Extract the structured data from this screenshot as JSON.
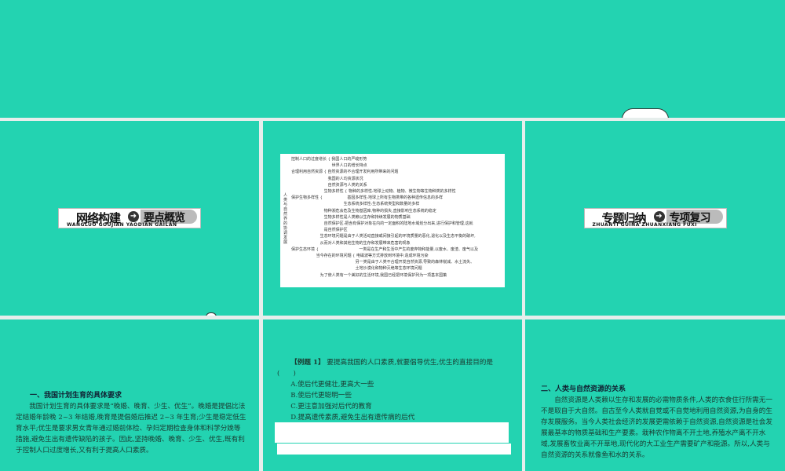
{
  "slides": [
    {
      "id": 1
    },
    {
      "id": 2,
      "banner": {
        "left": "网络构建",
        "right": "要点概览",
        "pinyin": "WANGLUO GOUJIAN YAODIAN GAILAN"
      }
    },
    {
      "id": 3,
      "mindmap": {
        "root": "人类与自然界的协调发展",
        "rows": [
          "控制人口的过度增长 { 我国人口的严峻形势",
          "　　　　　　　　　　 世界人口的增长特点",
          "合理利用自然资源 { 自然资源的不合理开发利用所带来的问题",
          "　　　　　　　　　 我国的人均资源状况",
          "　　　　　　　　　 自然资源与人类的关系",
          "　　　　　　　　 生物多样性 { 物种的多样性:地球上动物、植物、微生物等生物种类的多样性",
          "保护生物多样性 {　　　　　　 基因多样性:地球上所有生物携带的各种遗传信息的多样",
          "　　　　　　　　　　　　　 生态系统多样性:生态系统类型和数量的多样",
          "　　　　　　　　 物种濒危会危及生物基因库,物种的损失,直接影响生态系统的稳定",
          "　　　　　　　　 生物多样性是人类赖以生存和持续发展的物质基础",
          "　　　　　　　　 自然保护区:把含有保护对象在内的一定面积的陆地水域划分出来,进行保护和管理,这就",
          "　　　　　　　　 是自然保护区",
          "　　　　　　　 生态环境问题是由于人类活动直接或间接引起的环境质量的恶化,退化以及生态平衡的破坏,",
          "　　　　　　　 从而对人类和其他生物的生存和发展带来危害的现象",
          "保护生态环境 {　　　　　　　　　　 一类是在生产和生活中产生的废弃物和能量,以废水、废渣、废气以及",
          "　　　　　　 当今存在的环境问题 { 电磁波等方式排放到环境中,造成环境污染",
          "　　　　　　　　　　　　　　　　 另一类是由于人类不合理开发自然资源,导致的森林锐减、水土流失、",
          "　　　　　　　　　　　　　　　　 土地沙漠化和物种灭绝等生态环境问题",
          "　　　　　　　 为了使人类有一个美好的生活环境,我国已经把环境保护列为一项基本国策"
        ]
      }
    },
    {
      "id": 4,
      "banner": {
        "left": "专题归纳",
        "right": "专项复习",
        "pinyin": "ZHUANTI GUINA ZHUANXIANG FUXI"
      }
    },
    {
      "id": 5,
      "heading": "一、我国计划生育的具体要求",
      "body": "我国计划生育的具体要求是“晚婚、晚育、少生、优生”。晚婚是提倡比法定结婚年龄晚 2~3 年结婚,晚育是提倡婚后推迟 2~3 年生育;少生是稳定低生育水平;优生是要求男女青年通过婚前体检、孕妇定期检查身体和科学分娩等措施,避免生出有遗传缺陷的孩子。因此,坚持晚婚、晚育、少生、优生,既有利于控制人口过度增长,又有利于提高人口素质。"
    },
    {
      "id": 6,
      "question_label": "【例题 1】",
      "question": "要提高我国的人口素质,就要倡导优生,优生的直接目的是(　　)",
      "options": [
        "A.使后代更健壮,更高大一些",
        "B.使后代更聪明一些",
        "C.更注意加强对后代的教育",
        "D.提高遗传素质,避免生出有遗传病的后代"
      ]
    },
    {
      "id": 7,
      "heading": "二、人类与自然资源的关系",
      "body": "自然资源是人类赖以生存和发展的必需物质条件,人类的衣食住行所需无一不是取自于大自然。自古至今人类就自觉或不自觉地利用自然资源,为自身的生存发展服务。当今人类社会经济的发展更需依赖于自然资源,自然资源是社会发展最基本的物质基础和生产要素。栽种农作物离不开土地,养殖水产离不开水域,发展畜牧业离不开草地,现代化的大工业生产需要矿产和能源。所以,人类与自然资源的关系就像鱼和水的关系。"
    }
  ]
}
